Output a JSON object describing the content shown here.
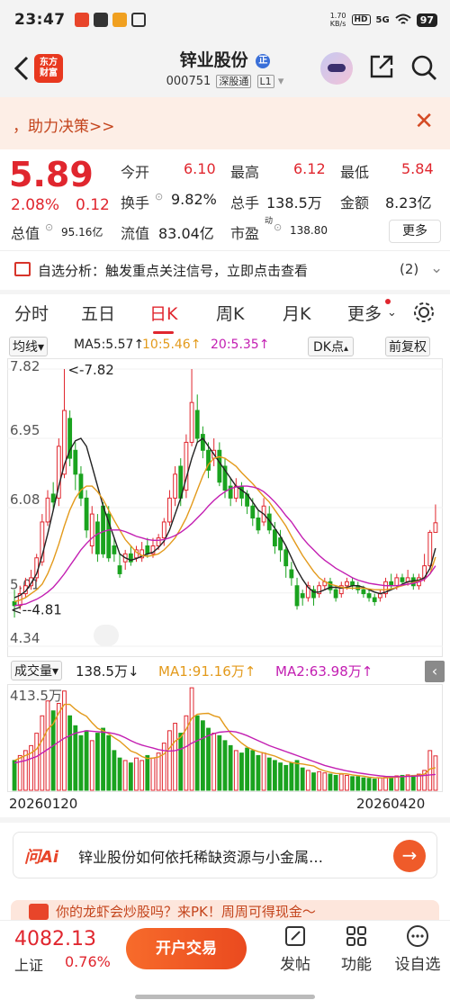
{
  "status": {
    "time": "23:47",
    "netspeed_top": "1.70",
    "netspeed_bottom": "KB/s",
    "hd": "HD",
    "signal": "5G",
    "battery": "97"
  },
  "header": {
    "title": "锌业股份",
    "title_badge": "正",
    "code": "000751",
    "market_tag": "深股通",
    "level_tag": "L1",
    "logo_line1": "东方",
    "logo_line2": "财富",
    "icons": [
      "back-icon",
      "app-logo",
      "assistant-avatar-icon",
      "share-icon",
      "search-icon"
    ]
  },
  "banner": {
    "text": "，助力决策>>",
    "close": "✕"
  },
  "quote": {
    "price": "5.89",
    "change_pct": "2.08%",
    "change": "0.12",
    "open_label": "今开",
    "open": "6.10",
    "high_label": "最高",
    "high": "6.12",
    "low_label": "最低",
    "low": "5.84",
    "turnover_label": "换手",
    "turnover": "9.82%",
    "volume_label": "总手",
    "volume": "138.5万",
    "amount_label": "金额",
    "amount": "8.23亿",
    "mktcap_label": "总值",
    "mktcap": "95.16亿",
    "float_label": "流值",
    "float": "83.04亿",
    "pe_label": "市盈",
    "pe_sup": "动",
    "pe": "138.80",
    "more": "更多"
  },
  "analysis": {
    "text": "自选分析：触发重点关注信号，立即点击查看",
    "count": "(2)",
    "arrow": "⌄"
  },
  "tabs": [
    "分时",
    "五日",
    "日K",
    "周K",
    "月K",
    "更多"
  ],
  "active_tab": 2,
  "chartbar": {
    "avg": "均线",
    "ma5": "MA5:5.57↑",
    "ma10": "10:5.46↑",
    "ma20": "20:5.35↑",
    "dk": "DK点",
    "fq": "前复权"
  },
  "volbar": {
    "label": "成交量",
    "vol": "138.5万↓",
    "ma1": "MA1:91.16万↑",
    "ma2": "MA2:63.98万↑",
    "toggle": "‹"
  },
  "colors": {
    "up": "#e0262e",
    "down": "#1aa31f",
    "ma5": "#222222",
    "ma10": "#e39a1b",
    "ma20": "#c31fb2"
  },
  "chart_data": {
    "type": "candlestick",
    "y_axis_ticks": [
      "7.82",
      "6.95",
      "6.08",
      "5.01",
      "4.34"
    ],
    "ylim": [
      4.34,
      7.82
    ],
    "annotations": [
      "<-7.82",
      "<--4.81"
    ],
    "x_range_labels": [
      "20260120",
      "20260420"
    ],
    "volume_max_label": "413.5万",
    "volume_ylim": [
      0,
      413.5
    ],
    "candles": [
      [
        4.9,
        4.85,
        5.05,
        4.7
      ],
      [
        4.85,
        5.0,
        5.1,
        4.8
      ],
      [
        5.0,
        5.1,
        5.2,
        4.95
      ],
      [
        5.1,
        5.2,
        5.3,
        5.05
      ],
      [
        5.2,
        5.45,
        5.5,
        5.15
      ],
      [
        5.4,
        5.9,
        6.0,
        5.35
      ],
      [
        5.9,
        6.2,
        6.3,
        5.85
      ],
      [
        6.25,
        6.15,
        6.4,
        6.05
      ],
      [
        6.2,
        6.85,
        6.95,
        6.1
      ],
      [
        6.5,
        7.3,
        7.82,
        6.45
      ],
      [
        7.2,
        6.7,
        7.3,
        6.6
      ],
      [
        6.8,
        6.5,
        6.9,
        6.3
      ],
      [
        6.5,
        6.2,
        6.6,
        6.1
      ],
      [
        6.2,
        5.8,
        6.3,
        5.7
      ],
      [
        5.6,
        6.0,
        6.1,
        5.5
      ],
      [
        5.9,
        5.5,
        6.0,
        5.4
      ],
      [
        6.1,
        5.5,
        6.15,
        5.45
      ],
      [
        6.0,
        5.45,
        6.1,
        5.4
      ],
      [
        5.6,
        5.5,
        5.7,
        5.4
      ],
      [
        5.35,
        5.25,
        5.5,
        5.2
      ],
      [
        5.4,
        5.5,
        5.55,
        5.3
      ],
      [
        5.5,
        5.4,
        5.6,
        5.35
      ],
      [
        5.45,
        5.55,
        5.6,
        5.4
      ],
      [
        5.45,
        5.55,
        5.65,
        5.4
      ],
      [
        5.6,
        5.5,
        5.7,
        5.45
      ],
      [
        5.5,
        5.6,
        5.7,
        5.45
      ],
      [
        5.6,
        5.7,
        5.75,
        5.55
      ],
      [
        5.7,
        5.9,
        5.95,
        5.6
      ],
      [
        5.9,
        6.2,
        6.3,
        5.85
      ],
      [
        6.2,
        6.5,
        6.6,
        6.1
      ],
      [
        6.6,
        6.2,
        6.7,
        6.1
      ],
      [
        6.3,
        6.9,
        7.0,
        6.2
      ],
      [
        6.9,
        7.4,
        7.82,
        6.85
      ],
      [
        7.3,
        6.95,
        7.5,
        6.9
      ],
      [
        7.0,
        6.8,
        7.1,
        6.7
      ],
      [
        6.8,
        6.55,
        6.9,
        6.45
      ],
      [
        6.7,
        6.8,
        6.95,
        6.6
      ],
      [
        6.8,
        6.4,
        6.9,
        6.35
      ],
      [
        6.6,
        6.3,
        6.7,
        6.2
      ],
      [
        6.35,
        6.2,
        6.45,
        6.1
      ],
      [
        6.2,
        6.35,
        6.45,
        6.15
      ],
      [
        6.35,
        6.2,
        6.4,
        6.1
      ],
      [
        6.25,
        6.1,
        6.3,
        6.0
      ],
      [
        6.1,
        5.95,
        6.2,
        5.85
      ],
      [
        5.95,
        5.8,
        6.05,
        5.75
      ],
      [
        5.9,
        6.1,
        6.2,
        5.85
      ],
      [
        6.0,
        5.8,
        6.1,
        5.75
      ],
      [
        5.8,
        5.6,
        5.9,
        5.5
      ],
      [
        5.7,
        5.55,
        5.8,
        5.4
      ],
      [
        5.55,
        5.35,
        5.6,
        5.2
      ],
      [
        5.3,
        5.2,
        5.4,
        5.1
      ],
      [
        5.1,
        4.85,
        5.2,
        4.8
      ],
      [
        5.0,
        4.95,
        5.05,
        4.85
      ],
      [
        4.95,
        5.1,
        5.15,
        4.9
      ],
      [
        5.05,
        4.95,
        5.1,
        4.85
      ],
      [
        5.0,
        5.1,
        5.15,
        4.95
      ],
      [
        5.1,
        5.15,
        5.2,
        5.05
      ],
      [
        5.15,
        5.05,
        5.2,
        5.0
      ],
      [
        5.05,
        4.95,
        5.1,
        4.9
      ],
      [
        5.0,
        5.1,
        5.15,
        4.95
      ],
      [
        5.1,
        5.15,
        5.2,
        5.05
      ],
      [
        5.15,
        5.1,
        5.2,
        5.05
      ],
      [
        5.1,
        5.05,
        5.15,
        5.0
      ],
      [
        5.05,
        5.0,
        5.1,
        4.95
      ],
      [
        5.0,
        4.95,
        5.05,
        4.9
      ],
      [
        4.95,
        4.9,
        5.0,
        4.85
      ],
      [
        4.95,
        5.0,
        5.05,
        4.9
      ],
      [
        5.0,
        5.15,
        5.2,
        4.95
      ],
      [
        5.15,
        5.1,
        5.25,
        5.05
      ],
      [
        5.1,
        5.2,
        5.25,
        5.05
      ],
      [
        5.2,
        5.15,
        5.25,
        5.1
      ],
      [
        5.15,
        5.2,
        5.3,
        5.1
      ],
      [
        5.2,
        5.1,
        5.25,
        5.05
      ],
      [
        5.1,
        5.2,
        5.25,
        5.05
      ],
      [
        5.2,
        5.35,
        5.5,
        5.15
      ],
      [
        5.35,
        5.77,
        5.8,
        5.3
      ],
      [
        5.77,
        5.89,
        6.12,
        5.84
      ]
    ],
    "ma5": [
      4.95,
      4.98,
      5.03,
      5.13,
      5.25,
      5.48,
      5.75,
      6.05,
      6.35,
      6.62,
      6.8,
      6.92,
      6.95,
      6.85,
      6.6,
      6.35,
      6.1,
      5.9,
      5.7,
      5.5,
      5.45,
      5.42,
      5.44,
      5.47,
      5.5,
      5.52,
      5.58,
      5.66,
      5.8,
      6.0,
      6.2,
      6.45,
      6.7,
      6.9,
      6.95,
      6.85,
      6.75,
      6.65,
      6.55,
      6.45,
      6.35,
      6.3,
      6.25,
      6.15,
      6.05,
      6.0,
      5.92,
      5.82,
      5.72,
      5.6,
      5.45,
      5.3,
      5.18,
      5.08,
      5.02,
      5.02,
      5.05,
      5.08,
      5.08,
      5.07,
      5.08,
      5.1,
      5.1,
      5.08,
      5.05,
      5.02,
      5.0,
      5.02,
      5.05,
      5.08,
      5.12,
      5.15,
      5.16,
      5.17,
      5.2,
      5.32,
      5.57
    ],
    "ma10": [
      4.9,
      4.92,
      4.95,
      5.0,
      5.05,
      5.12,
      5.25,
      5.42,
      5.62,
      5.85,
      6.05,
      6.2,
      6.3,
      6.35,
      6.35,
      6.28,
      6.18,
      6.05,
      5.92,
      5.8,
      5.68,
      5.6,
      5.52,
      5.48,
      5.47,
      5.48,
      5.5,
      5.55,
      5.62,
      5.7,
      5.82,
      5.95,
      6.12,
      6.3,
      6.48,
      6.62,
      6.7,
      6.72,
      6.7,
      6.65,
      6.6,
      6.52,
      6.45,
      6.38,
      6.3,
      6.22,
      6.15,
      6.05,
      5.95,
      5.85,
      5.72,
      5.6,
      5.48,
      5.38,
      5.28,
      5.2,
      5.15,
      5.12,
      5.1,
      5.08,
      5.07,
      5.07,
      5.07,
      5.07,
      5.06,
      5.05,
      5.05,
      5.05,
      5.06,
      5.08,
      5.1,
      5.12,
      5.14,
      5.16,
      5.18,
      5.25,
      5.46
    ],
    "ma20": [
      4.85,
      4.86,
      4.87,
      4.9,
      4.93,
      4.97,
      5.02,
      5.08,
      5.16,
      5.25,
      5.35,
      5.45,
      5.55,
      5.63,
      5.7,
      5.75,
      5.78,
      5.8,
      5.8,
      5.8,
      5.78,
      5.75,
      5.72,
      5.7,
      5.68,
      5.67,
      5.67,
      5.68,
      5.7,
      5.73,
      5.77,
      5.82,
      5.88,
      5.95,
      6.02,
      6.1,
      6.17,
      6.23,
      6.28,
      6.32,
      6.34,
      6.35,
      6.35,
      6.34,
      6.32,
      6.28,
      6.22,
      6.15,
      6.07,
      5.98,
      5.9,
      5.8,
      5.7,
      5.62,
      5.55,
      5.48,
      5.42,
      5.37,
      5.32,
      5.28,
      5.24,
      5.2,
      5.17,
      5.15,
      5.13,
      5.12,
      5.11,
      5.1,
      5.1,
      5.1,
      5.11,
      5.12,
      5.13,
      5.15,
      5.18,
      5.25,
      5.35
    ],
    "volume": [
      120,
      140,
      160,
      180,
      230,
      300,
      360,
      320,
      350,
      400,
      300,
      260,
      220,
      240,
      200,
      230,
      250,
      220,
      160,
      130,
      120,
      110,
      130,
      120,
      140,
      130,
      150,
      190,
      240,
      270,
      230,
      300,
      413,
      300,
      280,
      250,
      230,
      220,
      200,
      180,
      160,
      150,
      170,
      160,
      140,
      150,
      130,
      120,
      110,
      100,
      110,
      120,
      90,
      80,
      70,
      75,
      70,
      65,
      60,
      65,
      60,
      55,
      55,
      50,
      48,
      45,
      50,
      52,
      55,
      58,
      60,
      62,
      60,
      65,
      80,
      160,
      138.5
    ],
    "vol_ma1": [
      120,
      130,
      140,
      150,
      166,
      202,
      246,
      268,
      312,
      346,
      346,
      326,
      310,
      298,
      272,
      250,
      240,
      228,
      212,
      198,
      178,
      158,
      150,
      136,
      128,
      130,
      134,
      146,
      170,
      198,
      214,
      246,
      290,
      306,
      309,
      310,
      300,
      294,
      260,
      230,
      210,
      190,
      174,
      164,
      156,
      150,
      144,
      138,
      128,
      118,
      112,
      108,
      106,
      102,
      98,
      86,
      78,
      72,
      68,
      67,
      66,
      62,
      59,
      57,
      53,
      51,
      50,
      50,
      51,
      53,
      55,
      57,
      59,
      61,
      65,
      86,
      91.16
    ],
    "vol_ma2": [
      110,
      115,
      120,
      128,
      136,
      150,
      165,
      180,
      195,
      210,
      220,
      230,
      235,
      240,
      238,
      236,
      234,
      232,
      228,
      222,
      212,
      200,
      190,
      182,
      176,
      170,
      164,
      160,
      158,
      160,
      166,
      176,
      190,
      200,
      210,
      220,
      228,
      234,
      236,
      238,
      235,
      228,
      220,
      210,
      200,
      190,
      180,
      172,
      164,
      156,
      148,
      140,
      132,
      124,
      116,
      108,
      100,
      94,
      88,
      83,
      78,
      74,
      70,
      67,
      64,
      61,
      58,
      56,
      55,
      55,
      55,
      56,
      57,
      58,
      60,
      62,
      63.98
    ]
  },
  "ai": {
    "logo": "问Ai",
    "text": "锌业股份如何依托稀缺资源与小金属…",
    "go": "→"
  },
  "promo": {
    "text": "你的龙虾会炒股吗？来PK！周周可得现金～"
  },
  "bottom": {
    "index_value": "4082.13",
    "index_name": "上证",
    "index_pct": "0.76%",
    "open_label": "开户交易",
    "post_label": "发帖",
    "func_label": "功能",
    "alert_label": "设自选"
  }
}
